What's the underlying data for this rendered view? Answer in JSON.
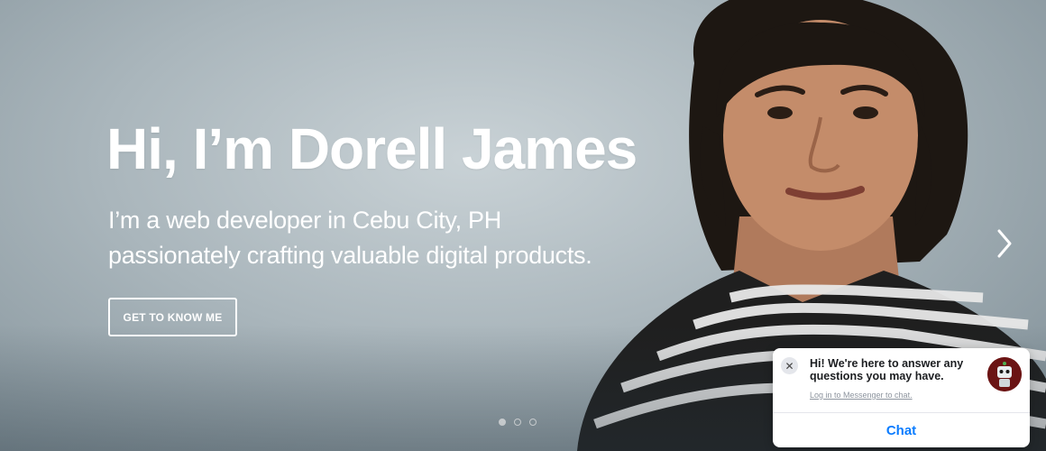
{
  "hero": {
    "headline": "Hi, I’m Dorell James",
    "subline_1": "I’m a web developer in Cebu City, PH",
    "subline_2": "passionately crafting valuable digital products.",
    "cta_label": "GET TO KNOW ME"
  },
  "carousel": {
    "slide_count": 3,
    "active_slide": 1,
    "next_icon": "chevron-right-icon"
  },
  "messenger": {
    "message": "Hi! We're here to answer any questions you may have.",
    "login_link": "Log in to Messenger to chat.",
    "chat_button": "Chat",
    "close_icon": "close-icon",
    "accent_color": "#0a7cff"
  },
  "colors": {
    "text": "#ffffff",
    "background": "#aab6bc"
  }
}
